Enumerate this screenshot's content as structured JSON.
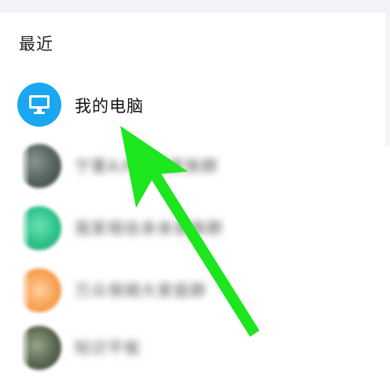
{
  "section": {
    "title": "最近"
  },
  "contacts": [
    {
      "name": "我的电脑",
      "icon": "monitor-icon",
      "color": "#1aa7f0"
    },
    {
      "name": "宁夏A大家庭家族群",
      "blurred": true
    },
    {
      "name": "我家相信亲亲家族群",
      "blurred": true
    },
    {
      "name": "万众保姆大家庭群",
      "blurred": true
    },
    {
      "name": "知识平板",
      "blurred": true
    }
  ],
  "overlay": {
    "arrow_color": "#1ee61e"
  }
}
